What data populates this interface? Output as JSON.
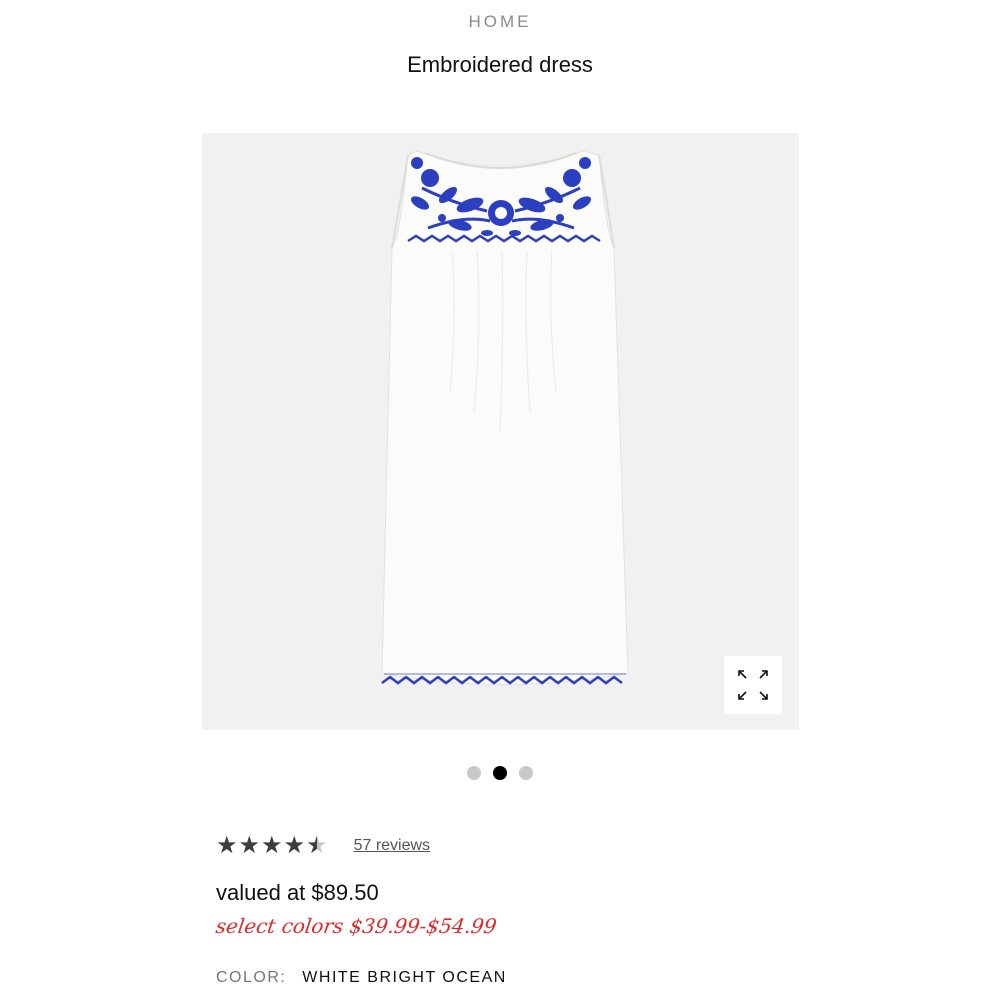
{
  "breadcrumb": "HOME",
  "product": {
    "title": "Embroidered dress",
    "rating": 4.5,
    "rating_max": 5,
    "reviews_label": "57 reviews",
    "valued_price": "valued at $89.50",
    "sale_price": "select colors $39.99-$54.99",
    "color_label": "COLOR:",
    "color_value": "WHITE BRIGHT OCEAN"
  },
  "carousel": {
    "total": 3,
    "active_index": 1
  },
  "icons": {
    "expand": "expand-icon",
    "star": "star-icon"
  },
  "colors": {
    "sale_red": "#d92b2b",
    "embroidery_blue": "#2b3fc0",
    "dress_white": "#fbfbf9",
    "image_bg": "#f1f1f1",
    "star_fill": "#3d3d3d"
  }
}
